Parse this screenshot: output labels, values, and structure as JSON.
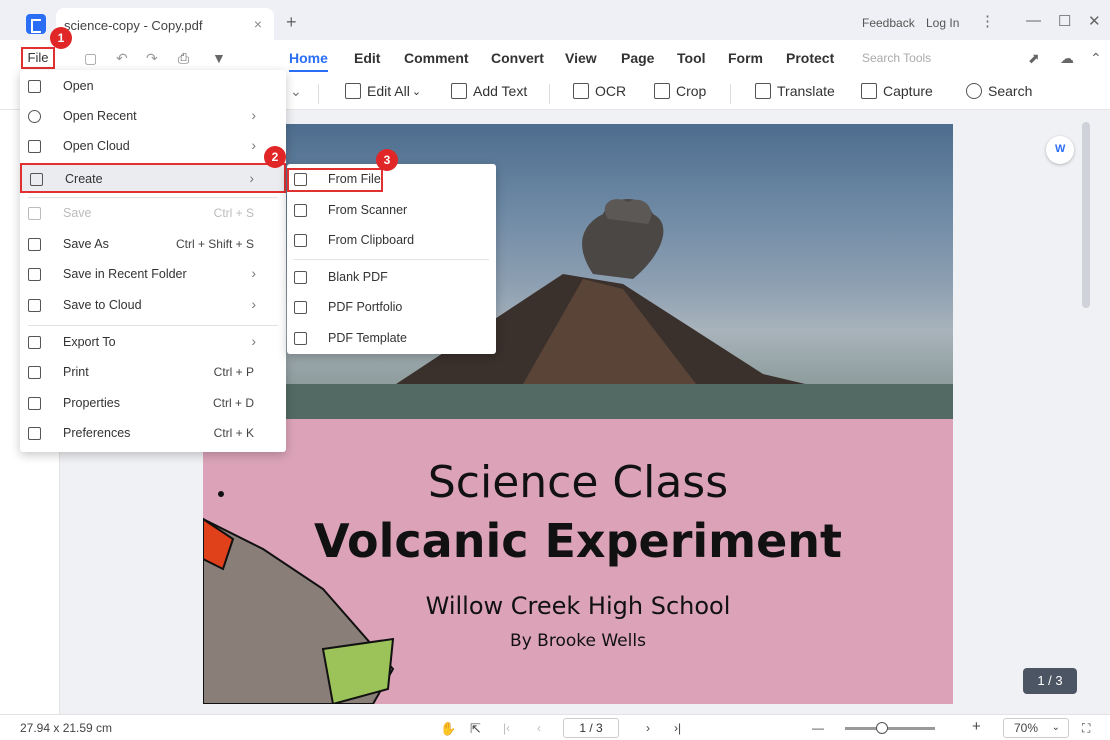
{
  "titlebar": {
    "tab_title": "science-copy - Copy.pdf",
    "close_glyph": "×",
    "new_tab_glyph": "+",
    "feedback": "Feedback",
    "login": "Log In",
    "more_glyph": "⋮",
    "minimize_glyph": "—",
    "maximize_glyph": "☐",
    "close_window_glyph": "✕"
  },
  "menubar": {
    "file": "File",
    "tabs": [
      "Home",
      "Edit",
      "Comment",
      "Convert",
      "View",
      "Page",
      "Tool",
      "Form",
      "Protect"
    ],
    "search_tools_placeholder": "Search Tools"
  },
  "toolbar": {
    "items": [
      "Edit All",
      "Add Text",
      "OCR",
      "Crop",
      "Translate",
      "Capture",
      "Search"
    ]
  },
  "file_menu": {
    "items": [
      {
        "label": "Open",
        "icon": "open-icon"
      },
      {
        "label": "Open Recent",
        "icon": "clock-icon",
        "submenu": true
      },
      {
        "label": "Open Cloud",
        "icon": "cloud-icon",
        "submenu": true
      },
      {
        "label": "Create",
        "icon": "create-icon",
        "submenu": true
      },
      {
        "label": "Save",
        "icon": "save-icon",
        "shortcut": "Ctrl + S",
        "disabled": true
      },
      {
        "label": "Save As",
        "icon": "save-as-icon",
        "shortcut": "Ctrl + Shift + S"
      },
      {
        "label": "Save in Recent Folder",
        "icon": "folder-icon",
        "submenu": true
      },
      {
        "label": "Save to Cloud",
        "icon": "upload-icon",
        "submenu": true
      },
      {
        "label": "Export To",
        "icon": "export-icon",
        "submenu": true
      },
      {
        "label": "Print",
        "icon": "print-icon",
        "shortcut": "Ctrl + P"
      },
      {
        "label": "Properties",
        "icon": "properties-icon",
        "shortcut": "Ctrl + D"
      },
      {
        "label": "Preferences",
        "icon": "preferences-icon",
        "shortcut": "Ctrl + K"
      }
    ],
    "arrow_glyph": "›"
  },
  "create_menu": {
    "items": [
      "From File",
      "From Scanner",
      "From Clipboard",
      "Blank PDF",
      "PDF Portfolio",
      "PDF Template"
    ]
  },
  "steps": [
    "1",
    "2",
    "3"
  ],
  "document": {
    "title_line1": "Science Class",
    "title_line2": "Volcanic Experiment",
    "school": "Willow Creek High School",
    "author": "By Brooke Wells",
    "page_indicator": "1 / 3"
  },
  "statusbar": {
    "page_size": "27.94 x 21.59 cm",
    "page_input": "1 / 3",
    "zoom": "70%",
    "zoom_minus": "—",
    "zoom_plus": "+"
  },
  "colors": {
    "accent": "#2b6ef6",
    "highlight_red": "#e03030",
    "cover_pink": "#dca3b8"
  }
}
